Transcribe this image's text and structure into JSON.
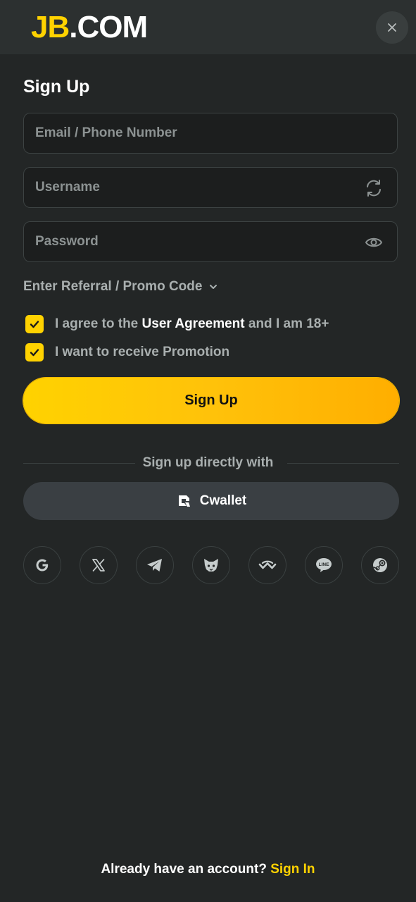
{
  "brand": {
    "logo_primary": "JB",
    "logo_secondary": ".COM",
    "accent_color": "#ffd200"
  },
  "header": {
    "close_icon": "close-icon"
  },
  "form": {
    "title": "Sign Up",
    "email": {
      "placeholder": "Email / Phone Number",
      "value": ""
    },
    "username": {
      "placeholder": "Username",
      "value": "",
      "icon": "refresh-icon"
    },
    "password": {
      "placeholder": "Password",
      "value": "",
      "icon": "eye-icon"
    },
    "referral_label": "Enter Referral / Promo Code",
    "agreement": {
      "prefix": "I agree to the ",
      "link": "User Agreement",
      "suffix": " and I am 18+",
      "checked": true
    },
    "promotion": {
      "label": "I want to receive Promotion",
      "checked": true
    },
    "submit_label": "Sign Up"
  },
  "alt_signup": {
    "divider_text": "Sign up directly with",
    "cwallet_label": "Cwallet",
    "providers": [
      "google-icon",
      "x-icon",
      "telegram-icon",
      "metamask-icon",
      "walletconnect-icon",
      "line-icon",
      "steam-icon"
    ]
  },
  "footer": {
    "prompt": "Already have an account? ",
    "link": "Sign In"
  }
}
